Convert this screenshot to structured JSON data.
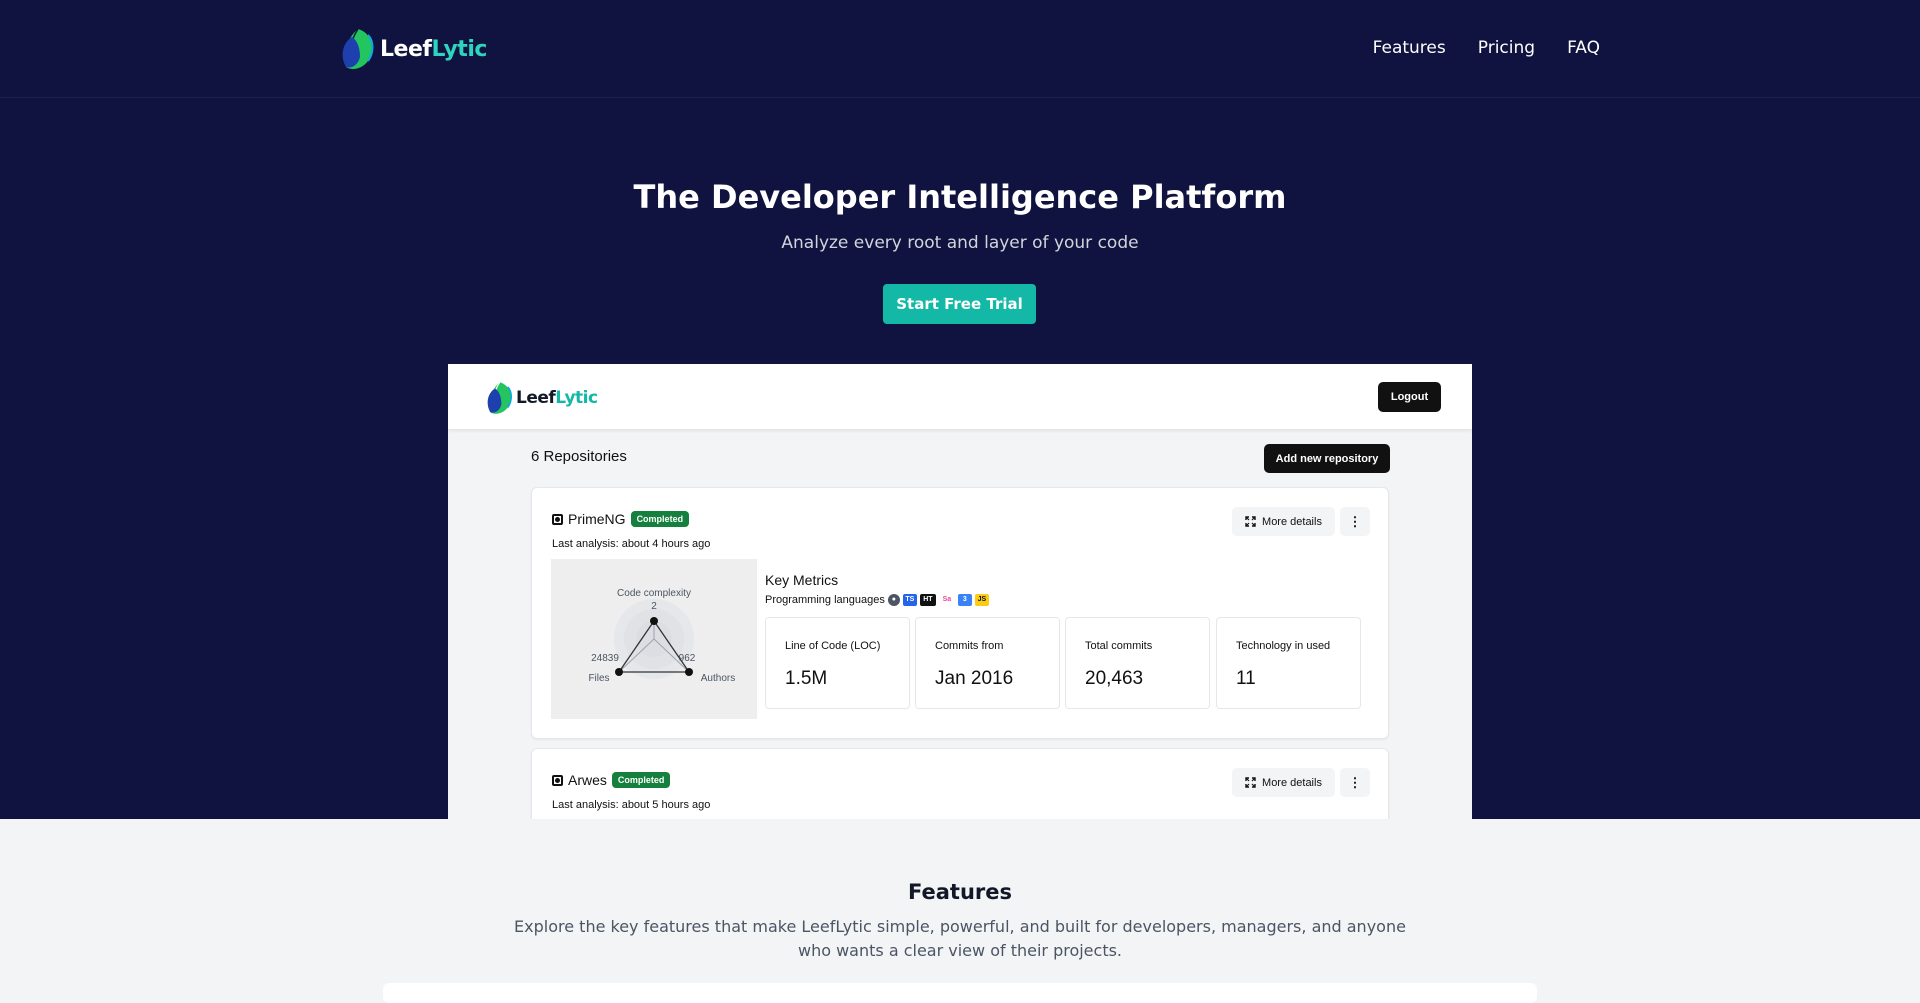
{
  "brand": {
    "part1": "Leef",
    "part2": "Lytic"
  },
  "nav": {
    "links": [
      "Features",
      "Pricing",
      "FAQ"
    ]
  },
  "hero": {
    "title": "The Developer Intelligence Platform",
    "subtitle": "Analyze every root and layer of your code",
    "cta": "Start Free Trial"
  },
  "preview": {
    "logout": "Logout",
    "repo_count": "6 Repositories",
    "add_repo": "Add new repository",
    "cards": [
      {
        "name": "PrimeNG",
        "status": "Completed",
        "last_analysis": "Last analysis: about 4 hours ago",
        "more_details": "More details",
        "radar": {
          "labels": {
            "top": "Code complexity",
            "left": "Files",
            "right": "Authors"
          },
          "values": {
            "top": "2",
            "left": "24839",
            "right": "962"
          }
        },
        "key_metrics_title": "Key Metrics",
        "languages_label": "Programming languages",
        "language_icons": [
          "node-icon",
          "typescript-icon",
          "html-icon",
          "sass-icon",
          "css3-icon",
          "javascript-icon"
        ],
        "metrics": [
          {
            "label": "Line of Code (LOC)",
            "value": "1.5M"
          },
          {
            "label": "Commits from",
            "value": "Jan 2016"
          },
          {
            "label": "Total commits",
            "value": "20,463"
          },
          {
            "label": "Technology in used",
            "value": "11"
          }
        ]
      },
      {
        "name": "Arwes",
        "status": "Completed",
        "last_analysis": "Last analysis: about 5 hours ago",
        "more_details": "More details"
      }
    ]
  },
  "features": {
    "title": "Features",
    "subtitle": "Explore the key features that make LeefLytic simple, powerful, and built for developers, managers, and anyone who wants a clear view of their projects."
  },
  "colors": {
    "nav_bg": "#10133f",
    "accent": "#14b8a6",
    "badge": "#15803d",
    "page_bg": "#f3f4f6"
  }
}
